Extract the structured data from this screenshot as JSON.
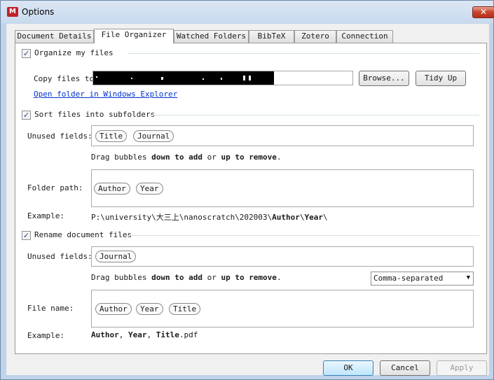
{
  "window": {
    "title": "Options",
    "close_symbol": "✕",
    "app_icon_letter": "M"
  },
  "tabs": [
    {
      "label": "Document Details",
      "selected": false
    },
    {
      "label": "File Organizer",
      "selected": true
    },
    {
      "label": "Watched Folders",
      "selected": false
    },
    {
      "label": "BibTeX",
      "selected": false
    },
    {
      "label": "Zotero",
      "selected": false
    },
    {
      "label": "Connection",
      "selected": false
    }
  ],
  "organize": {
    "checkbox_label": "Organize my files",
    "checked": true,
    "copy_label": "Copy files to:",
    "copy_value": "",
    "browse_label": "Browse...",
    "tidy_label": "Tidy Up",
    "open_link": "Open folder in Windows Explorer"
  },
  "sort": {
    "checkbox_label": "Sort files into subfolders",
    "checked": true,
    "unused_label": "Unused fields:",
    "unused_bubbles": [
      "Title",
      "Journal"
    ],
    "hint_prefix": "Drag bubbles ",
    "hint_down": "down to add",
    "hint_or": " or ",
    "hint_up": "up to remove",
    "hint_suffix": ".",
    "path_label": "Folder path:",
    "path_bubbles": [
      "Author",
      "Year"
    ],
    "example_label": "Example:",
    "example_prefix": "P:\\university\\大三上\\nanoscratch\\202003\\",
    "example_author": "Author",
    "example_sep": "\\",
    "example_year": "Year",
    "example_end": "\\"
  },
  "rename": {
    "checkbox_label": "Rename document files",
    "checked": true,
    "unused_label": "Unused fields:",
    "unused_bubbles": [
      "Journal"
    ],
    "hint_prefix": "Drag bubbles ",
    "hint_down": "down to add",
    "hint_or": " or ",
    "hint_up": "up to remove",
    "hint_suffix": ".",
    "separator_selected": "Comma-separated",
    "name_label": "File name:",
    "name_bubbles": [
      "Author",
      "Year",
      "Title"
    ],
    "example_label": "Example:",
    "example_author": "Author",
    "example_c1": ", ",
    "example_year": "Year",
    "example_c2": ", ",
    "example_title": "Title",
    "example_ext": ".pdf"
  },
  "footer": {
    "ok": "OK",
    "cancel": "Cancel",
    "apply": "Apply"
  },
  "colors": {
    "link": "#0033cc",
    "panel": "#ffffff",
    "dialog": "#f0f0f0",
    "close": "#c7432a"
  }
}
